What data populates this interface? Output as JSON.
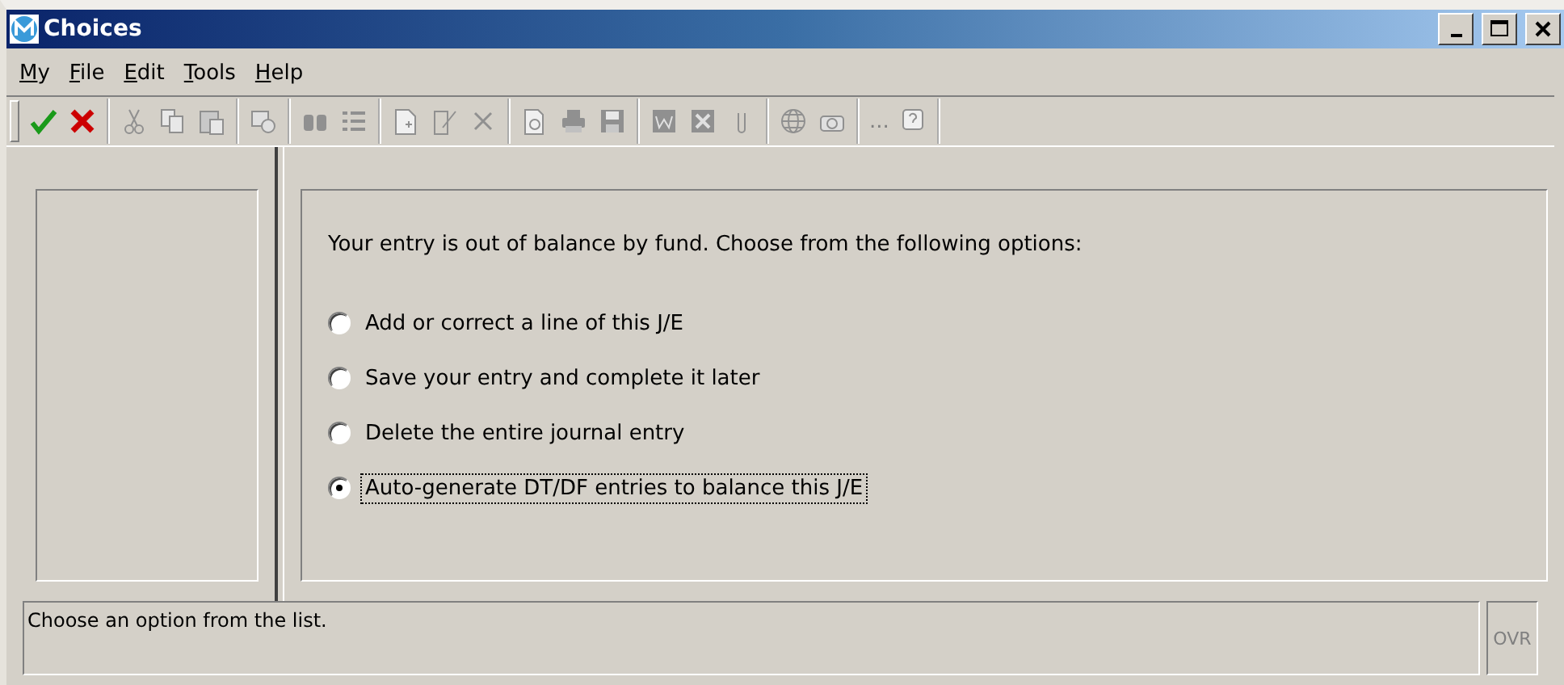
{
  "window": {
    "title": "Choices"
  },
  "menu": [
    "My",
    "File",
    "Edit",
    "Tools",
    "Help"
  ],
  "toolbar": {
    "more": "..."
  },
  "prompt": "Your entry is out of balance by fund. Choose from the following options:",
  "options": [
    {
      "label": "Add or correct a line of this J/E",
      "selected": false
    },
    {
      "label": "Save your entry and complete it later",
      "selected": false
    },
    {
      "label": "Delete the entire journal entry",
      "selected": false
    },
    {
      "label": "Auto-generate DT/DF entries to balance this J/E",
      "selected": true
    }
  ],
  "status_bar": {
    "message": "Choose an option from the list.",
    "mode": "OVR"
  }
}
